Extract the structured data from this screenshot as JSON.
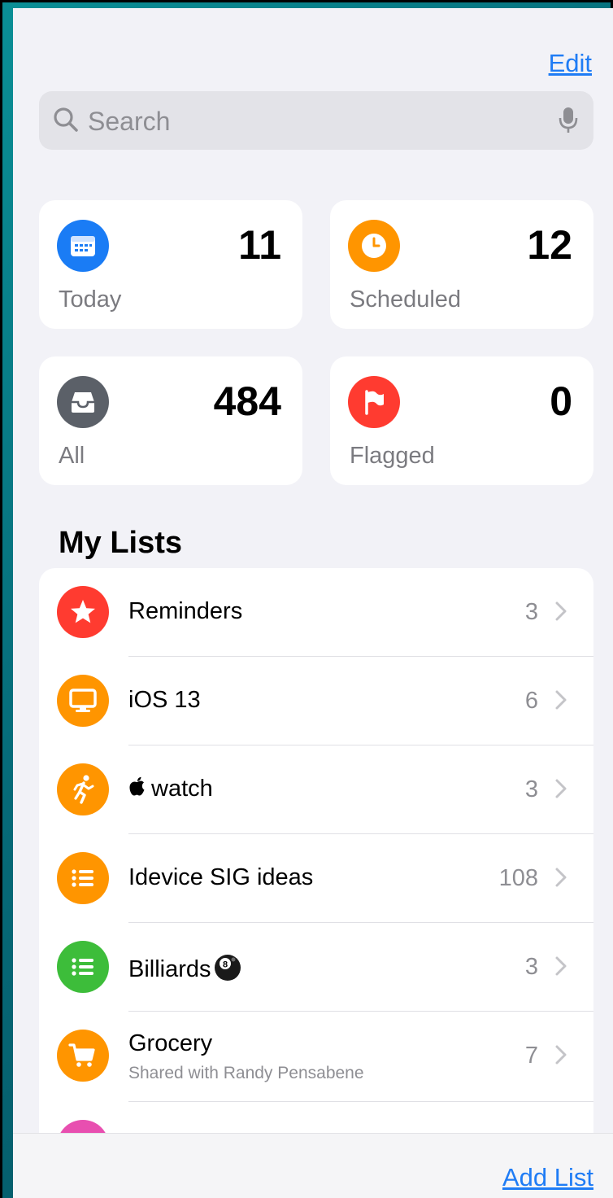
{
  "header": {
    "edit_label": "Edit"
  },
  "search": {
    "placeholder": "Search",
    "value": ""
  },
  "smart_lists": {
    "today": {
      "label": "Today",
      "count": "11",
      "color": "#1a7cf5"
    },
    "scheduled": {
      "label": "Scheduled",
      "count": "12",
      "color": "#ff9500"
    },
    "all": {
      "label": "All",
      "count": "484",
      "color": "#5b6068"
    },
    "flagged": {
      "label": "Flagged",
      "count": "0",
      "color": "#ff3b30"
    }
  },
  "my_lists": {
    "title": "My Lists",
    "items": [
      {
        "title": "Reminders",
        "count": "3",
        "icon": "star-icon",
        "color": "#ff3b30"
      },
      {
        "title": "iOS 13",
        "count": "6",
        "icon": "desktop-icon",
        "color": "#ff9500"
      },
      {
        "title": "watch",
        "count": "3",
        "icon": "running-figure-icon",
        "color": "#ff9500"
      },
      {
        "title": "Idevice SIG ideas",
        "count": "108",
        "icon": "list-bullets-icon",
        "color": "#ff9500"
      },
      {
        "title": "Billiards",
        "count": "3",
        "icon": "list-bullets-icon",
        "color": "#3dbd3a"
      },
      {
        "title": "Grocery",
        "subtitle": "Shared with Randy Pensabene",
        "count": "7",
        "icon": "cart-icon",
        "color": "#ff9500"
      },
      {
        "title": "",
        "icon": "list-icon",
        "color": "#e84fb0"
      }
    ]
  },
  "footer": {
    "add_list_label": "Add List"
  }
}
